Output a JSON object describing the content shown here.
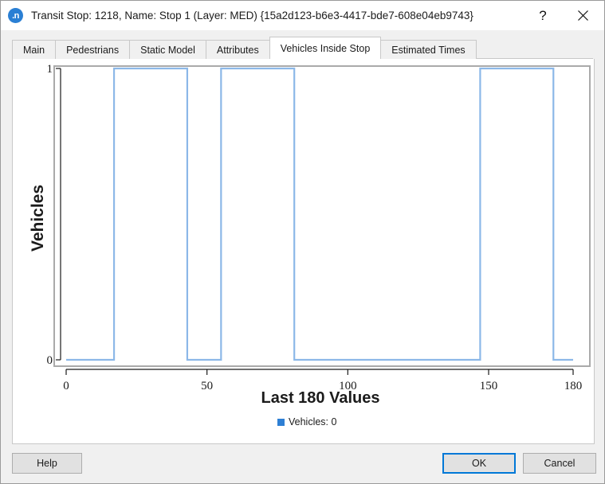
{
  "window": {
    "icon": "app-icon-n",
    "title": "Transit Stop: 1218, Name: Stop 1 (Layer: MED) {15a2d123-b6e3-4417-bde7-608e04eb9743}",
    "help_glyph": "?",
    "close_glyph": "close-icon"
  },
  "tabs": [
    {
      "label": "Main",
      "active": false
    },
    {
      "label": "Pedestrians",
      "active": false
    },
    {
      "label": "Static Model",
      "active": false
    },
    {
      "label": "Attributes",
      "active": false
    },
    {
      "label": "Vehicles Inside Stop",
      "active": true
    },
    {
      "label": "Estimated Times",
      "active": false
    }
  ],
  "footer": {
    "help_label": "Help",
    "ok_label": "OK",
    "cancel_label": "Cancel"
  },
  "colors": {
    "accent": "#0078d7",
    "series_line": "#8cb8e8",
    "legend_marker": "#2e7fd4",
    "panel_border": "#c8c8c8",
    "axis": "#1b1b1b",
    "plot_frame": "#aaaaaa"
  },
  "chart_data": {
    "type": "line",
    "title": "",
    "xlabel": "Last 180 Values",
    "ylabel": "Vehicles",
    "xlim": [
      0,
      180
    ],
    "ylim": [
      0,
      1
    ],
    "xticks": [
      0,
      50,
      100,
      150,
      180
    ],
    "xticklabels": [
      "0",
      "50",
      "100",
      "150",
      "180"
    ],
    "yticks": [
      0,
      1
    ],
    "yticklabels": [
      "0",
      "1"
    ],
    "grid": false,
    "legend_position": "bottom-center",
    "legend": [
      {
        "label": "Vehicles: 0",
        "color": "#2e7fd4"
      }
    ],
    "series": [
      {
        "name": "Vehicles",
        "color": "#8cb8e8",
        "step": "post",
        "x": [
          0,
          17,
          17,
          43,
          43,
          55,
          55,
          81,
          81,
          147,
          147,
          173,
          173,
          180
        ],
        "y": [
          0,
          0,
          1,
          1,
          0,
          0,
          1,
          1,
          0,
          0,
          1,
          1,
          0,
          0
        ]
      }
    ]
  }
}
